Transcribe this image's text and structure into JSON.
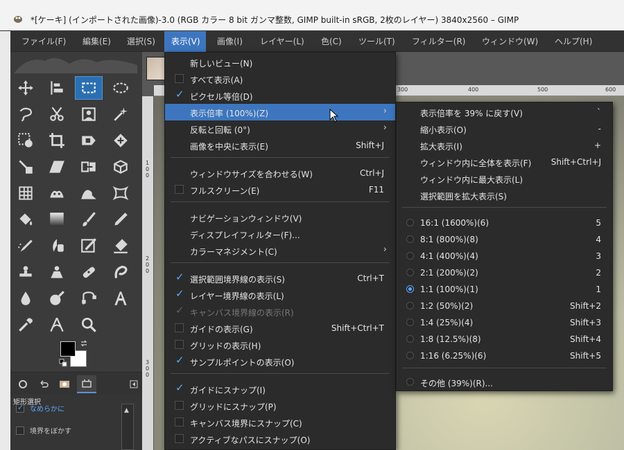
{
  "window": {
    "title": "*[ケーキ] (インポートされた画像)-3.0 (RGB カラー 8 bit ガンマ整数, GIMP built-in sRGB, 2枚のレイヤー) 3840x2560 – GIMP"
  },
  "menubar": [
    "ファイル(F)",
    "編集(E)",
    "選択(S)",
    "表示(V)",
    "画像(I)",
    "レイヤー(L)",
    "色(C)",
    "ツール(T)",
    "フィルター(R)",
    "ウィンドウ(W)",
    "ヘルプ(H)"
  ],
  "rulers": {
    "h": [
      "300",
      "400",
      "500",
      "600"
    ],
    "v": [
      "1",
      "0",
      "0",
      "2",
      "0",
      "0",
      "3",
      "0",
      "0"
    ]
  },
  "tool_options": {
    "title": "矩形選択",
    "antialias": "なめらかに",
    "feather": "境界をぼかす"
  },
  "view_menu": {
    "items": [
      {
        "label": "新しいビュー(N)",
        "shortcut": "",
        "check": "none"
      },
      {
        "label": "すべて表示(A)",
        "shortcut": "",
        "check": "off"
      },
      {
        "label": "ピクセル等倍(D)",
        "shortcut": "",
        "check": "on"
      },
      {
        "label": "表示倍率 (100%)(Z)",
        "shortcut": "",
        "check": "none",
        "submenu": true,
        "highlight": true
      },
      {
        "label": "反転と回転 (0°)",
        "shortcut": "",
        "check": "none",
        "submenu": true
      },
      {
        "label": "画像を中央に表示(E)",
        "shortcut": "Shift+J",
        "check": "none"
      },
      {
        "label": "ウィンドウサイズを合わせる(W)",
        "shortcut": "Ctrl+J",
        "check": "none"
      },
      {
        "label": "フルスクリーン(E)",
        "shortcut": "F11",
        "check": "off"
      },
      {
        "label": "ナビゲーションウィンドウ(V)",
        "shortcut": "",
        "check": "none"
      },
      {
        "label": "ディスプレイフィルター(F)...",
        "shortcut": "",
        "check": "none"
      },
      {
        "label": "カラーマネジメント(C)",
        "shortcut": "",
        "check": "none",
        "submenu": true
      },
      {
        "label": "選択範囲境界線の表示(S)",
        "shortcut": "Ctrl+T",
        "check": "on"
      },
      {
        "label": "レイヤー境界線の表示(L)",
        "shortcut": "",
        "check": "on"
      },
      {
        "label": "キャンバス境界線の表示(R)",
        "shortcut": "",
        "check": "on",
        "disabled": true
      },
      {
        "label": "ガイドの表示(G)",
        "shortcut": "Shift+Ctrl+T",
        "check": "off"
      },
      {
        "label": "グリッドの表示(H)",
        "shortcut": "",
        "check": "off"
      },
      {
        "label": "サンプルポイントの表示(O)",
        "shortcut": "",
        "check": "on"
      },
      {
        "label": "ガイドにスナップ(I)",
        "shortcut": "",
        "check": "on"
      },
      {
        "label": "グリッドにスナップ(P)",
        "shortcut": "",
        "check": "off"
      },
      {
        "label": "キャンバス境界にスナップ(C)",
        "shortcut": "",
        "check": "off"
      },
      {
        "label": "アクティブなパスにスナップ(O)",
        "shortcut": "",
        "check": "off"
      }
    ]
  },
  "zoom_submenu": {
    "items": [
      {
        "label": "表示倍率を 39% に戻す(V)",
        "shortcut": "`"
      },
      {
        "label": "縮小表示(O)",
        "shortcut": "-"
      },
      {
        "label": "拡大表示(I)",
        "shortcut": "+"
      },
      {
        "label": "ウィンドウ内に全体を表示(F)",
        "shortcut": "Shift+Ctrl+J"
      },
      {
        "label": "ウィンドウ内に最大表示(L)",
        "shortcut": ""
      },
      {
        "label": "選択範囲を拡大表示(S)",
        "shortcut": ""
      }
    ],
    "ratios": [
      {
        "label": "16:1 (1600%)(6)",
        "shortcut": "5",
        "selected": false
      },
      {
        "label": "8:1 (800%)(8)",
        "shortcut": "4",
        "selected": false
      },
      {
        "label": "4:1 (400%)(4)",
        "shortcut": "3",
        "selected": false
      },
      {
        "label": "2:1 (200%)(2)",
        "shortcut": "2",
        "selected": false
      },
      {
        "label": "1:1 (100%)(1)",
        "shortcut": "1",
        "selected": true
      },
      {
        "label": "1:2 (50%)(2)",
        "shortcut": "Shift+2",
        "selected": false
      },
      {
        "label": "1:4 (25%)(4)",
        "shortcut": "Shift+3",
        "selected": false
      },
      {
        "label": "1:8 (12.5%)(8)",
        "shortcut": "Shift+4",
        "selected": false
      },
      {
        "label": "1:16 (6.25%)(6)",
        "shortcut": "Shift+5",
        "selected": false
      }
    ],
    "other": {
      "label": "その他 (39%)(R)...",
      "shortcut": ""
    }
  }
}
